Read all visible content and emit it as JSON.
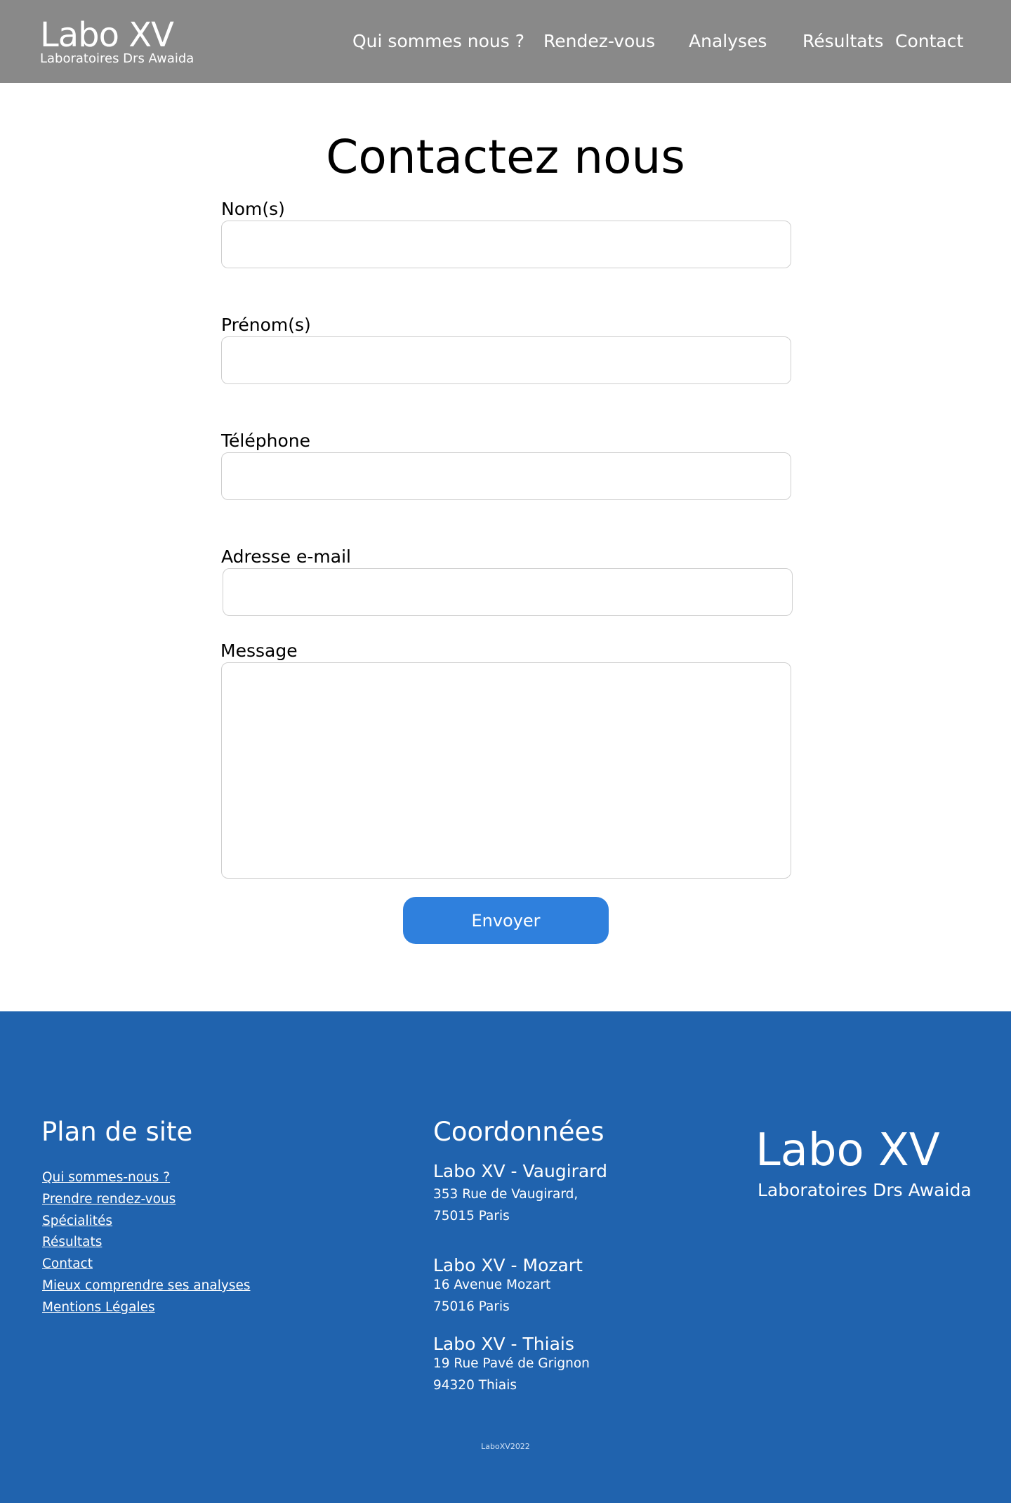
{
  "header": {
    "brand_title": "Labo XV",
    "brand_subtitle": "Laboratoires Drs Awaida",
    "nav": [
      "Qui sommes nous ?",
      "Rendez-vous",
      "Analyses",
      "Résultats",
      "Contact"
    ]
  },
  "main": {
    "title": "Contactez nous",
    "fields": {
      "nom": {
        "label": "Nom(s)",
        "value": ""
      },
      "prenom": {
        "label": "Prénom(s)",
        "value": ""
      },
      "telephone": {
        "label": "Téléphone",
        "value": ""
      },
      "email": {
        "label": "Adresse e-mail",
        "value": ""
      },
      "message": {
        "label": "Message",
        "value": ""
      }
    },
    "submit_label": "Envoyer"
  },
  "footer": {
    "sitemap_title": "Plan de site",
    "sitemap_links": [
      "Qui sommes-nous ?",
      "Prendre rendez-vous",
      "Spécialités",
      "Résultats",
      "Contact",
      "Mieux comprendre ses analyses",
      "Mentions Légales"
    ],
    "contact_title": "Coordonnées",
    "sites": [
      {
        "name": "Labo XV - Vaugirard",
        "address": "353 Rue de Vaugirard,",
        "city": "75015 Paris"
      },
      {
        "name": "Labo XV - Mozart",
        "address": "16 Avenue Mozart",
        "city": "75016 Paris"
      },
      {
        "name": "Labo XV - Thiais",
        "address": "19 Rue Pavé de Grignon",
        "city": "94320 Thiais"
      }
    ],
    "brand_title": "Labo XV",
    "brand_subtitle": "Laboratoires Drs Awaida",
    "copyright": "LaboXV2022"
  },
  "colors": {
    "header_bg": "#898989",
    "footer_bg": "#2063ae",
    "button_bg": "#2f80dd",
    "text_light": "#ffffff"
  }
}
